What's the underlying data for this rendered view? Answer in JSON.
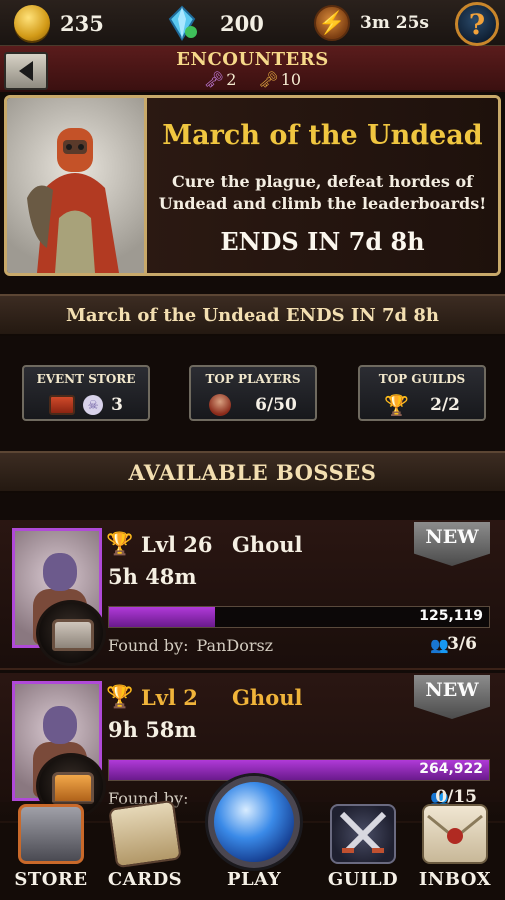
{
  "topbar": {
    "gold": "235",
    "gems": "200",
    "energy_timer": "3m 25s",
    "help_symbol": "?"
  },
  "encounters": {
    "title": "ENCOUNTERS",
    "key1_count": "2",
    "key2_count": "10"
  },
  "event": {
    "title": "March of the Undead",
    "description_line1": "Cure the plague, defeat hordes of",
    "description_line2": "Undead and climb the leaderboards!",
    "ends": "ENDS IN 7d 8h",
    "banner_ends": "March of the Undead ENDS IN 7d 8h"
  },
  "event_buttons": [
    {
      "label": "EVENT STORE",
      "value": "3",
      "icon": "chest-icon",
      "icon2": "skull-icon"
    },
    {
      "label": "TOP PLAYERS",
      "value": "6/50",
      "icon": "player-head-icon"
    },
    {
      "label": "TOP GUILDS",
      "value": "2/2",
      "icon": "trophy-icon"
    }
  ],
  "bosses_header": "AVAILABLE BOSSES",
  "bosses": [
    {
      "level": "Lvl 26",
      "name": "Ghoul",
      "time": "5h 48m",
      "new_label": "NEW",
      "hp": "125,119",
      "hp_fraction": 0.28,
      "found_label": "Found by:",
      "found_by": "PanDorsz",
      "party": "3/6",
      "trophy": "silver",
      "chest": "silver"
    },
    {
      "level": "Lvl 2",
      "name": "Ghoul",
      "time": "9h 58m",
      "new_label": "NEW",
      "hp": "264,922",
      "hp_fraction": 1.0,
      "found_label": "Found by:",
      "found_by": "",
      "party": "0/15",
      "trophy": "gold",
      "chest": "gold"
    }
  ],
  "nav": {
    "store": "STORE",
    "cards": "CARDS",
    "play": "PLAY",
    "guild": "GUILD",
    "inbox": "INBOX"
  }
}
